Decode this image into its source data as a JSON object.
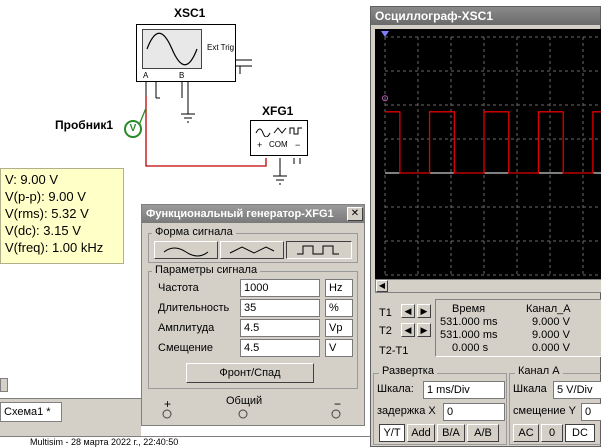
{
  "schematic": {
    "xsc_label": "XSC1",
    "ext_trig_label": "Ext Trig",
    "channel_a": "A",
    "channel_b": "B",
    "xfg_label": "XFG1",
    "com_label": "COM",
    "plus_label": "+",
    "minus_label": "−",
    "probe_label": "Пробник1",
    "probe_symbol": "V",
    "probe_readings": [
      "V: 9.00 V",
      "V(p-p): 9.00 V",
      "V(rms): 5.32 V",
      "V(dc): 3.15 V",
      "V(freq): 1.00 kHz"
    ]
  },
  "function_generator": {
    "title": "Функциональный генератор-XFG1",
    "close_label": "✕",
    "waveform_group": "Форма сигнала",
    "params_group": "Параметры сигнала",
    "params": [
      {
        "label": "Частота",
        "value": "1000",
        "unit": "Hz"
      },
      {
        "label": "Длительность",
        "value": "35",
        "unit": "%"
      },
      {
        "label": "Амплитуда",
        "value": "4.5",
        "unit": "Vp"
      },
      {
        "label": "Смещение",
        "value": "4.5",
        "unit": "V"
      }
    ],
    "rise_fall_button": "Фронт/Спад",
    "plus_terminal": "+",
    "common_terminal": "Общий",
    "minus_terminal": "−"
  },
  "oscilloscope": {
    "title": "Осциллограф-XSC1",
    "t1_label": "T1",
    "t2_label": "T2",
    "t2t1_label": "T2-T1",
    "time_header": "Время",
    "channel_header": "Канал_A",
    "rows": [
      {
        "time": "531.000 ms",
        "value": "9.000 V"
      },
      {
        "time": "531.000 ms",
        "value": "9.000 V"
      },
      {
        "time": "0.000 s",
        "value": "0.000 V"
      }
    ],
    "sweep_group": "Развертка",
    "sweep_scale_label": "Шкала:",
    "sweep_scale_value": "1 ms/Div",
    "delay_label": "задержка X",
    "delay_value": "0",
    "sweep_buttons": [
      "Y/T",
      "Add",
      "B/A",
      "A/B"
    ],
    "channel_group": "Канал A",
    "channel_scale_label": "Шкала",
    "channel_scale_value": "5  V/Div",
    "offset_label": "смещение Y",
    "offset_value": "0",
    "coupling_buttons": [
      "AC",
      "0",
      "DC"
    ],
    "trace_color": "#e00000",
    "pulse": {
      "period_ms": 1,
      "duty_percent": 35,
      "high_v": 9,
      "low_v": 0,
      "volts_per_div": 5,
      "ms_per_div": 1
    }
  },
  "taskbar": {
    "tab_label": "Схема1 *",
    "status_text": "Multisim  -  28 марта 2022 г., 22:40:50"
  }
}
